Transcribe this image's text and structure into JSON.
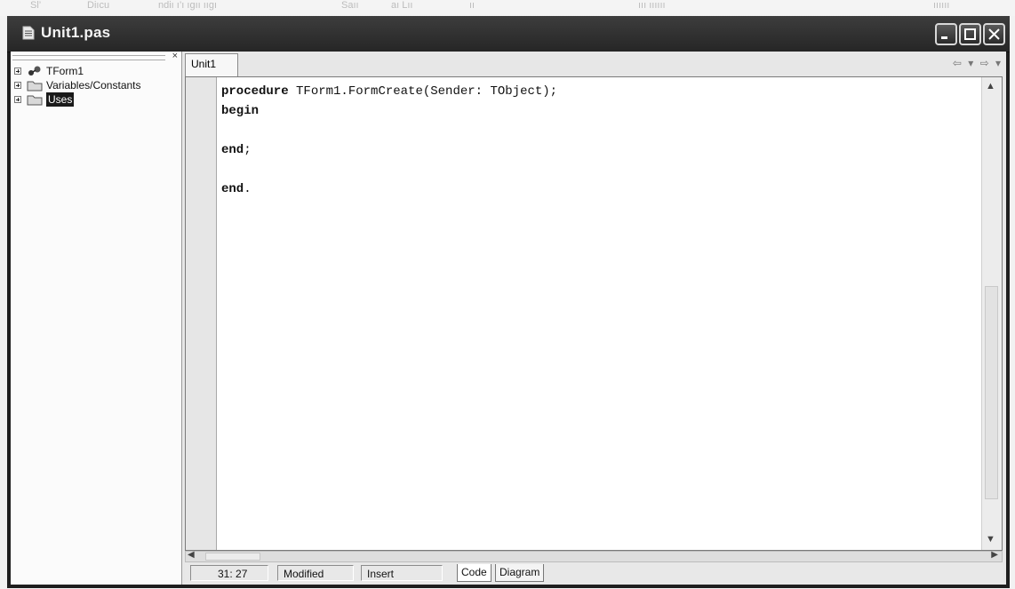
{
  "window": {
    "title": "Unit1.pas"
  },
  "top_strip_text": [
    "Sl’",
    "Diıcu",
    "ndiı ı’ı ıgıı ııgı",
    "Saıı",
    "aı Lıı",
    "ıı",
    "ııı ıııııı",
    "ıııııı"
  ],
  "tree": {
    "items": [
      {
        "label": "TForm1",
        "icon": "component-icon",
        "selected": false
      },
      {
        "label": "Variables/Constants",
        "icon": "folder-icon",
        "selected": false
      },
      {
        "label": "Uses",
        "icon": "folder-icon",
        "selected": true
      }
    ]
  },
  "editor": {
    "tab": "Unit1",
    "nav_back": "⇦ ▾",
    "nav_forward": "⇨ ▾",
    "code_lines": [
      {
        "kw": "procedure",
        "rest": " TForm1.FormCreate(Sender: TObject);"
      },
      {
        "kw": "begin",
        "rest": ""
      },
      {
        "kw": "",
        "rest": ""
      },
      {
        "kw": "end",
        "rest": ";"
      },
      {
        "kw": "",
        "rest": ""
      },
      {
        "kw": "end",
        "rest": "."
      }
    ]
  },
  "status": {
    "position": "31: 27",
    "modified": "Modified",
    "mode": "Insert",
    "tab_code": "Code",
    "tab_diagram": "Diagram"
  }
}
